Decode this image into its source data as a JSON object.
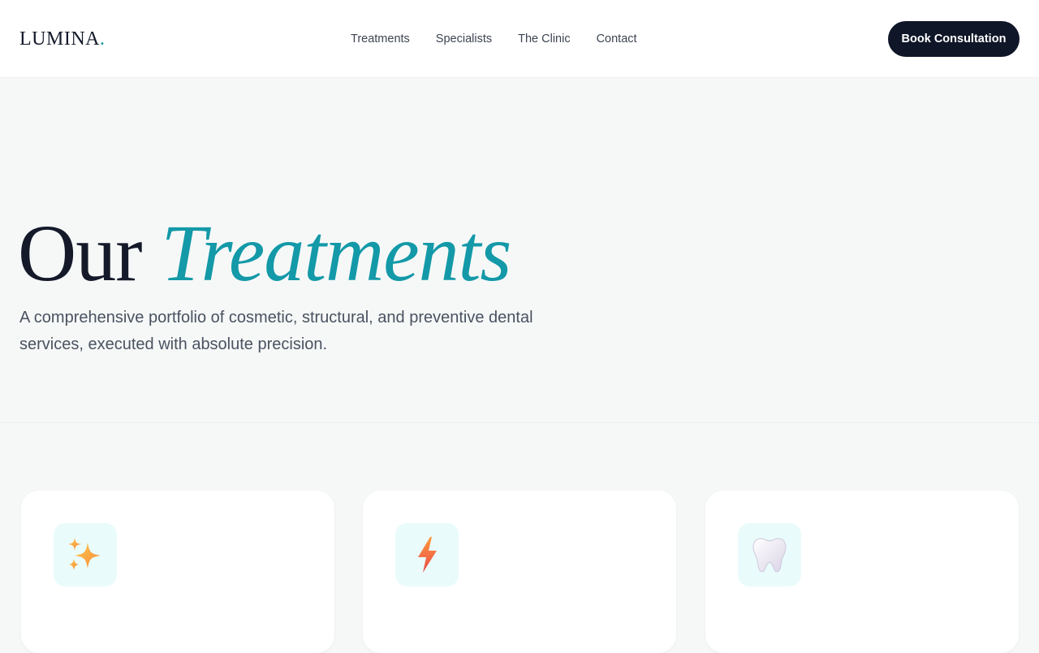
{
  "brand": {
    "name": "LUMINA",
    "dot": "."
  },
  "nav": {
    "items": [
      {
        "label": "Treatments"
      },
      {
        "label": "Specialists"
      },
      {
        "label": "The Clinic"
      },
      {
        "label": "Contact"
      }
    ],
    "cta_label": "Book Consultation"
  },
  "hero": {
    "title_plain": "Our",
    "title_accent": "Treatments",
    "subtitle": "A comprehensive portfolio of cosmetic, structural, and preventive dental services, executed with absolute precision."
  },
  "cards": [
    {
      "icon": "sparkles-icon"
    },
    {
      "icon": "lightning-icon"
    },
    {
      "icon": "tooth-icon"
    }
  ],
  "colors": {
    "accent": "#1399a8",
    "dark": "#0f1628",
    "background": "#f6f8f8",
    "icon_bg": "#eafbfb"
  }
}
